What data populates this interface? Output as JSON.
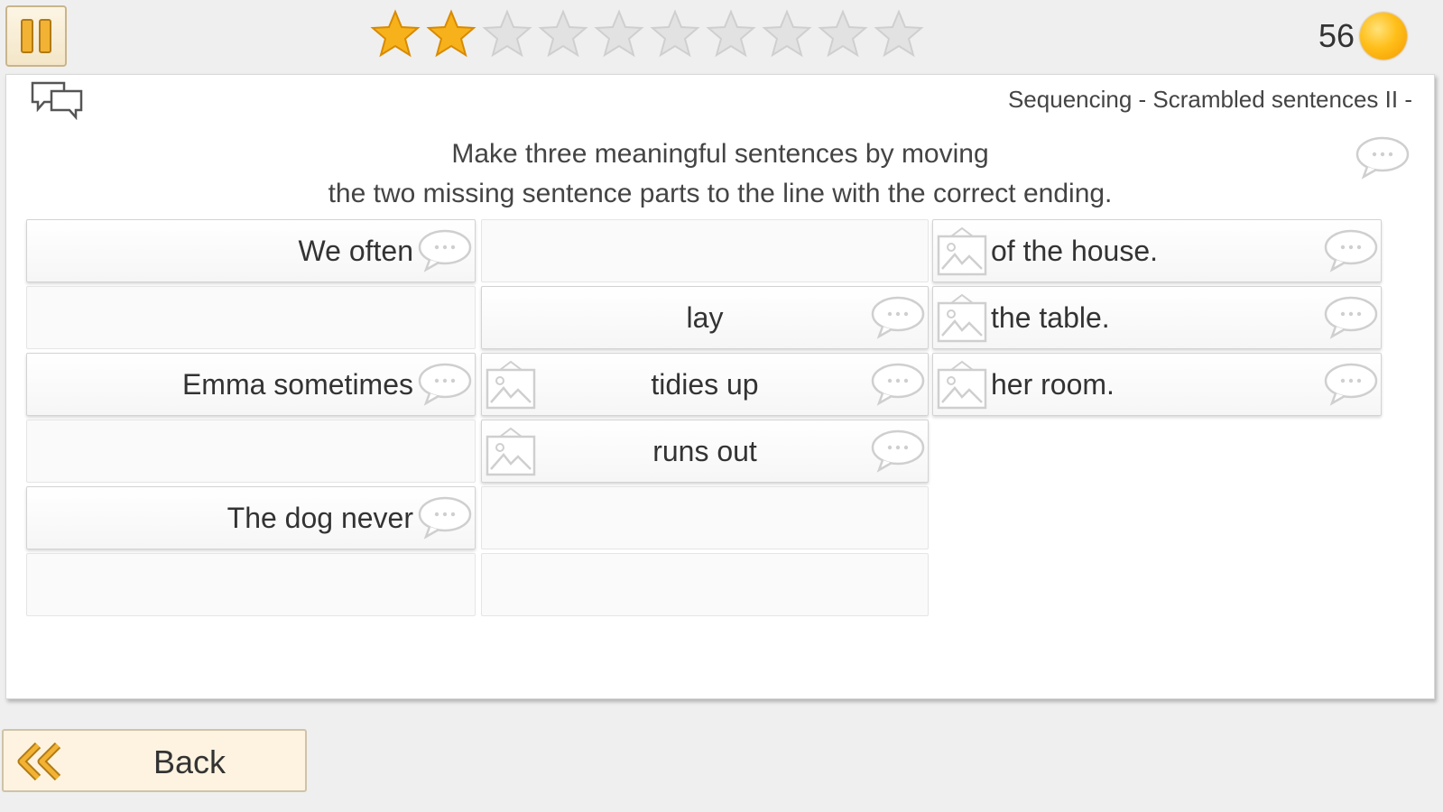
{
  "header": {
    "stars_total": 10,
    "stars_earned": 2,
    "coins": "56"
  },
  "panel": {
    "title": "Sequencing - Scrambled sentences II -",
    "instruction_line1": "Make three meaningful sentences by moving",
    "instruction_line2": "the two missing sentence parts to the line with the correct ending."
  },
  "rows": [
    {
      "col1": "We often",
      "col2": "",
      "col3": "of the house."
    },
    {
      "col1": "",
      "col2": "lay",
      "col3": "the table."
    },
    {
      "col1": "Emma sometimes",
      "col2": "tidies up",
      "col3": "her room."
    },
    {
      "col1": "",
      "col2": "runs out",
      "col3": ""
    },
    {
      "col1": "The dog never",
      "col2": "",
      "col3": ""
    },
    {
      "col1": "",
      "col2": "",
      "col3": ""
    }
  ],
  "footer": {
    "back_label": "Back"
  },
  "colors": {
    "star_gold": "#f7b21b",
    "star_empty": "#e2e2e2",
    "coin": "#ffbf1a",
    "back_bg": "#fdf3e0"
  }
}
